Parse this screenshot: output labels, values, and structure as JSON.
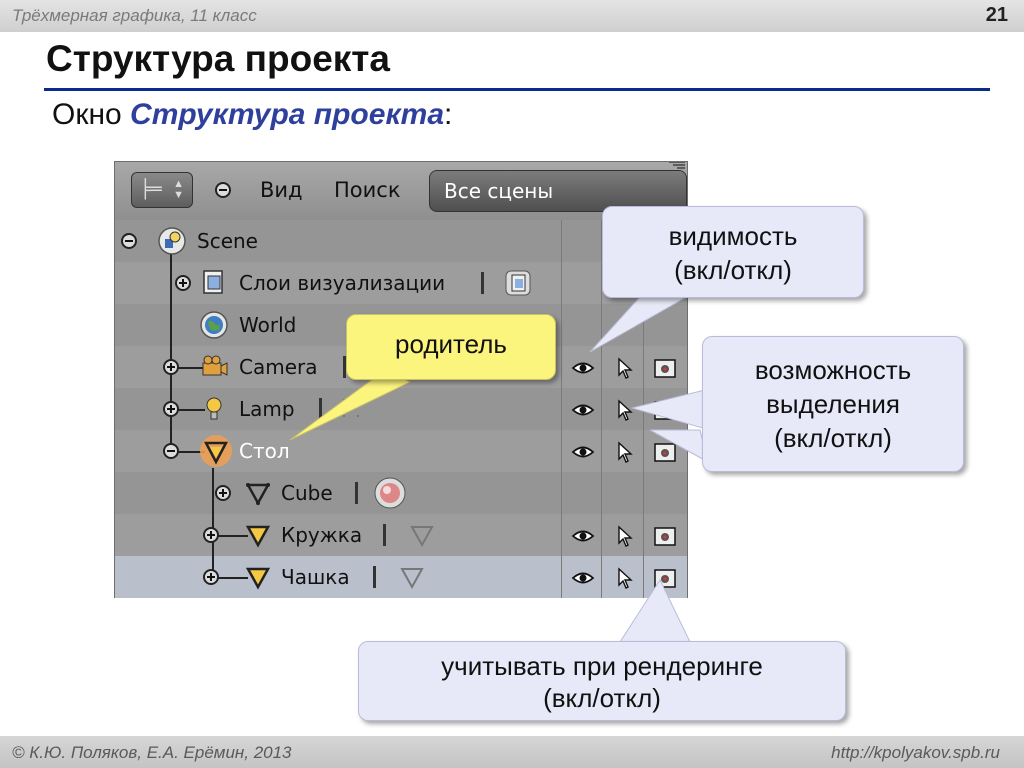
{
  "slide": {
    "course": "Трёхмерная графика, 11 класс",
    "page_number": "21",
    "title": "Структура проекта",
    "subtitle_prefix": "Окно ",
    "subtitle_em": "Структура проекта",
    "subtitle_suffix": ":"
  },
  "outliner": {
    "menu_view": "Вид",
    "menu_search": "Поиск",
    "scene_selector": "Все сцены",
    "rows": [
      {
        "label": "Scene"
      },
      {
        "label": "Слои визуализации"
      },
      {
        "label": "World"
      },
      {
        "label": "Camera"
      },
      {
        "label": "Lamp"
      },
      {
        "label": "Стол"
      },
      {
        "label": "Cube"
      },
      {
        "label": "Кружка"
      },
      {
        "label": "Чашка"
      }
    ],
    "icons": {
      "visibility": "eye-icon",
      "selectability": "cursor-icon",
      "renderability": "camera-icon"
    }
  },
  "callouts": {
    "parent": "родитель",
    "visibility_line1": "видимость",
    "visibility_line2": "(вкл/откл)",
    "select_line1": "возможность",
    "select_line2": "выделения",
    "select_line3": "(вкл/откл)",
    "render_line1": "учитывать при рендеринге",
    "render_line2": "(вкл/откл)"
  },
  "footer": {
    "authors": "© К.Ю. Поляков, Е.А. Ерёмин, 2013",
    "url": "http://kpolyakov.spb.ru"
  },
  "colors": {
    "title_rule": "#0a2a8c",
    "accent_text": "#2f3f9c",
    "yellow_callout": "#fbf47d",
    "blue_callout": "#e8e9f8",
    "selected_row": "#b9c0cc"
  }
}
